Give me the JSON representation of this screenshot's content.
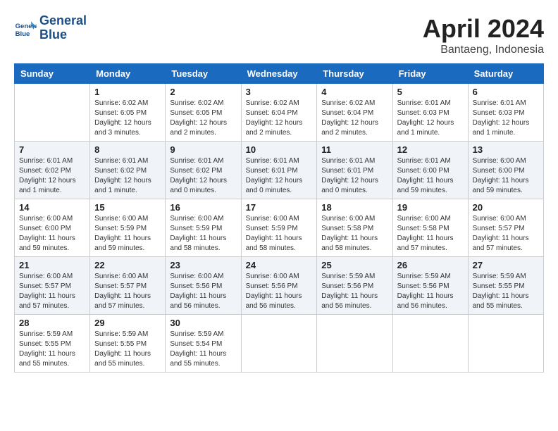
{
  "header": {
    "logo_line1": "General",
    "logo_line2": "Blue",
    "month": "April 2024",
    "location": "Bantaeng, Indonesia"
  },
  "columns": [
    "Sunday",
    "Monday",
    "Tuesday",
    "Wednesday",
    "Thursday",
    "Friday",
    "Saturday"
  ],
  "weeks": [
    [
      {
        "day": "",
        "info": ""
      },
      {
        "day": "1",
        "info": "Sunrise: 6:02 AM\nSunset: 6:05 PM\nDaylight: 12 hours\nand 3 minutes."
      },
      {
        "day": "2",
        "info": "Sunrise: 6:02 AM\nSunset: 6:05 PM\nDaylight: 12 hours\nand 2 minutes."
      },
      {
        "day": "3",
        "info": "Sunrise: 6:02 AM\nSunset: 6:04 PM\nDaylight: 12 hours\nand 2 minutes."
      },
      {
        "day": "4",
        "info": "Sunrise: 6:02 AM\nSunset: 6:04 PM\nDaylight: 12 hours\nand 2 minutes."
      },
      {
        "day": "5",
        "info": "Sunrise: 6:01 AM\nSunset: 6:03 PM\nDaylight: 12 hours\nand 1 minute."
      },
      {
        "day": "6",
        "info": "Sunrise: 6:01 AM\nSunset: 6:03 PM\nDaylight: 12 hours\nand 1 minute."
      }
    ],
    [
      {
        "day": "7",
        "info": "Sunrise: 6:01 AM\nSunset: 6:02 PM\nDaylight: 12 hours\nand 1 minute."
      },
      {
        "day": "8",
        "info": "Sunrise: 6:01 AM\nSunset: 6:02 PM\nDaylight: 12 hours\nand 1 minute."
      },
      {
        "day": "9",
        "info": "Sunrise: 6:01 AM\nSunset: 6:02 PM\nDaylight: 12 hours\nand 0 minutes."
      },
      {
        "day": "10",
        "info": "Sunrise: 6:01 AM\nSunset: 6:01 PM\nDaylight: 12 hours\nand 0 minutes."
      },
      {
        "day": "11",
        "info": "Sunrise: 6:01 AM\nSunset: 6:01 PM\nDaylight: 12 hours\nand 0 minutes."
      },
      {
        "day": "12",
        "info": "Sunrise: 6:01 AM\nSunset: 6:00 PM\nDaylight: 11 hours\nand 59 minutes."
      },
      {
        "day": "13",
        "info": "Sunrise: 6:00 AM\nSunset: 6:00 PM\nDaylight: 11 hours\nand 59 minutes."
      }
    ],
    [
      {
        "day": "14",
        "info": "Sunrise: 6:00 AM\nSunset: 6:00 PM\nDaylight: 11 hours\nand 59 minutes."
      },
      {
        "day": "15",
        "info": "Sunrise: 6:00 AM\nSunset: 5:59 PM\nDaylight: 11 hours\nand 59 minutes."
      },
      {
        "day": "16",
        "info": "Sunrise: 6:00 AM\nSunset: 5:59 PM\nDaylight: 11 hours\nand 58 minutes."
      },
      {
        "day": "17",
        "info": "Sunrise: 6:00 AM\nSunset: 5:59 PM\nDaylight: 11 hours\nand 58 minutes."
      },
      {
        "day": "18",
        "info": "Sunrise: 6:00 AM\nSunset: 5:58 PM\nDaylight: 11 hours\nand 58 minutes."
      },
      {
        "day": "19",
        "info": "Sunrise: 6:00 AM\nSunset: 5:58 PM\nDaylight: 11 hours\nand 57 minutes."
      },
      {
        "day": "20",
        "info": "Sunrise: 6:00 AM\nSunset: 5:57 PM\nDaylight: 11 hours\nand 57 minutes."
      }
    ],
    [
      {
        "day": "21",
        "info": "Sunrise: 6:00 AM\nSunset: 5:57 PM\nDaylight: 11 hours\nand 57 minutes."
      },
      {
        "day": "22",
        "info": "Sunrise: 6:00 AM\nSunset: 5:57 PM\nDaylight: 11 hours\nand 57 minutes."
      },
      {
        "day": "23",
        "info": "Sunrise: 6:00 AM\nSunset: 5:56 PM\nDaylight: 11 hours\nand 56 minutes."
      },
      {
        "day": "24",
        "info": "Sunrise: 6:00 AM\nSunset: 5:56 PM\nDaylight: 11 hours\nand 56 minutes."
      },
      {
        "day": "25",
        "info": "Sunrise: 5:59 AM\nSunset: 5:56 PM\nDaylight: 11 hours\nand 56 minutes."
      },
      {
        "day": "26",
        "info": "Sunrise: 5:59 AM\nSunset: 5:56 PM\nDaylight: 11 hours\nand 56 minutes."
      },
      {
        "day": "27",
        "info": "Sunrise: 5:59 AM\nSunset: 5:55 PM\nDaylight: 11 hours\nand 55 minutes."
      }
    ],
    [
      {
        "day": "28",
        "info": "Sunrise: 5:59 AM\nSunset: 5:55 PM\nDaylight: 11 hours\nand 55 minutes."
      },
      {
        "day": "29",
        "info": "Sunrise: 5:59 AM\nSunset: 5:55 PM\nDaylight: 11 hours\nand 55 minutes."
      },
      {
        "day": "30",
        "info": "Sunrise: 5:59 AM\nSunset: 5:54 PM\nDaylight: 11 hours\nand 55 minutes."
      },
      {
        "day": "",
        "info": ""
      },
      {
        "day": "",
        "info": ""
      },
      {
        "day": "",
        "info": ""
      },
      {
        "day": "",
        "info": ""
      }
    ]
  ]
}
